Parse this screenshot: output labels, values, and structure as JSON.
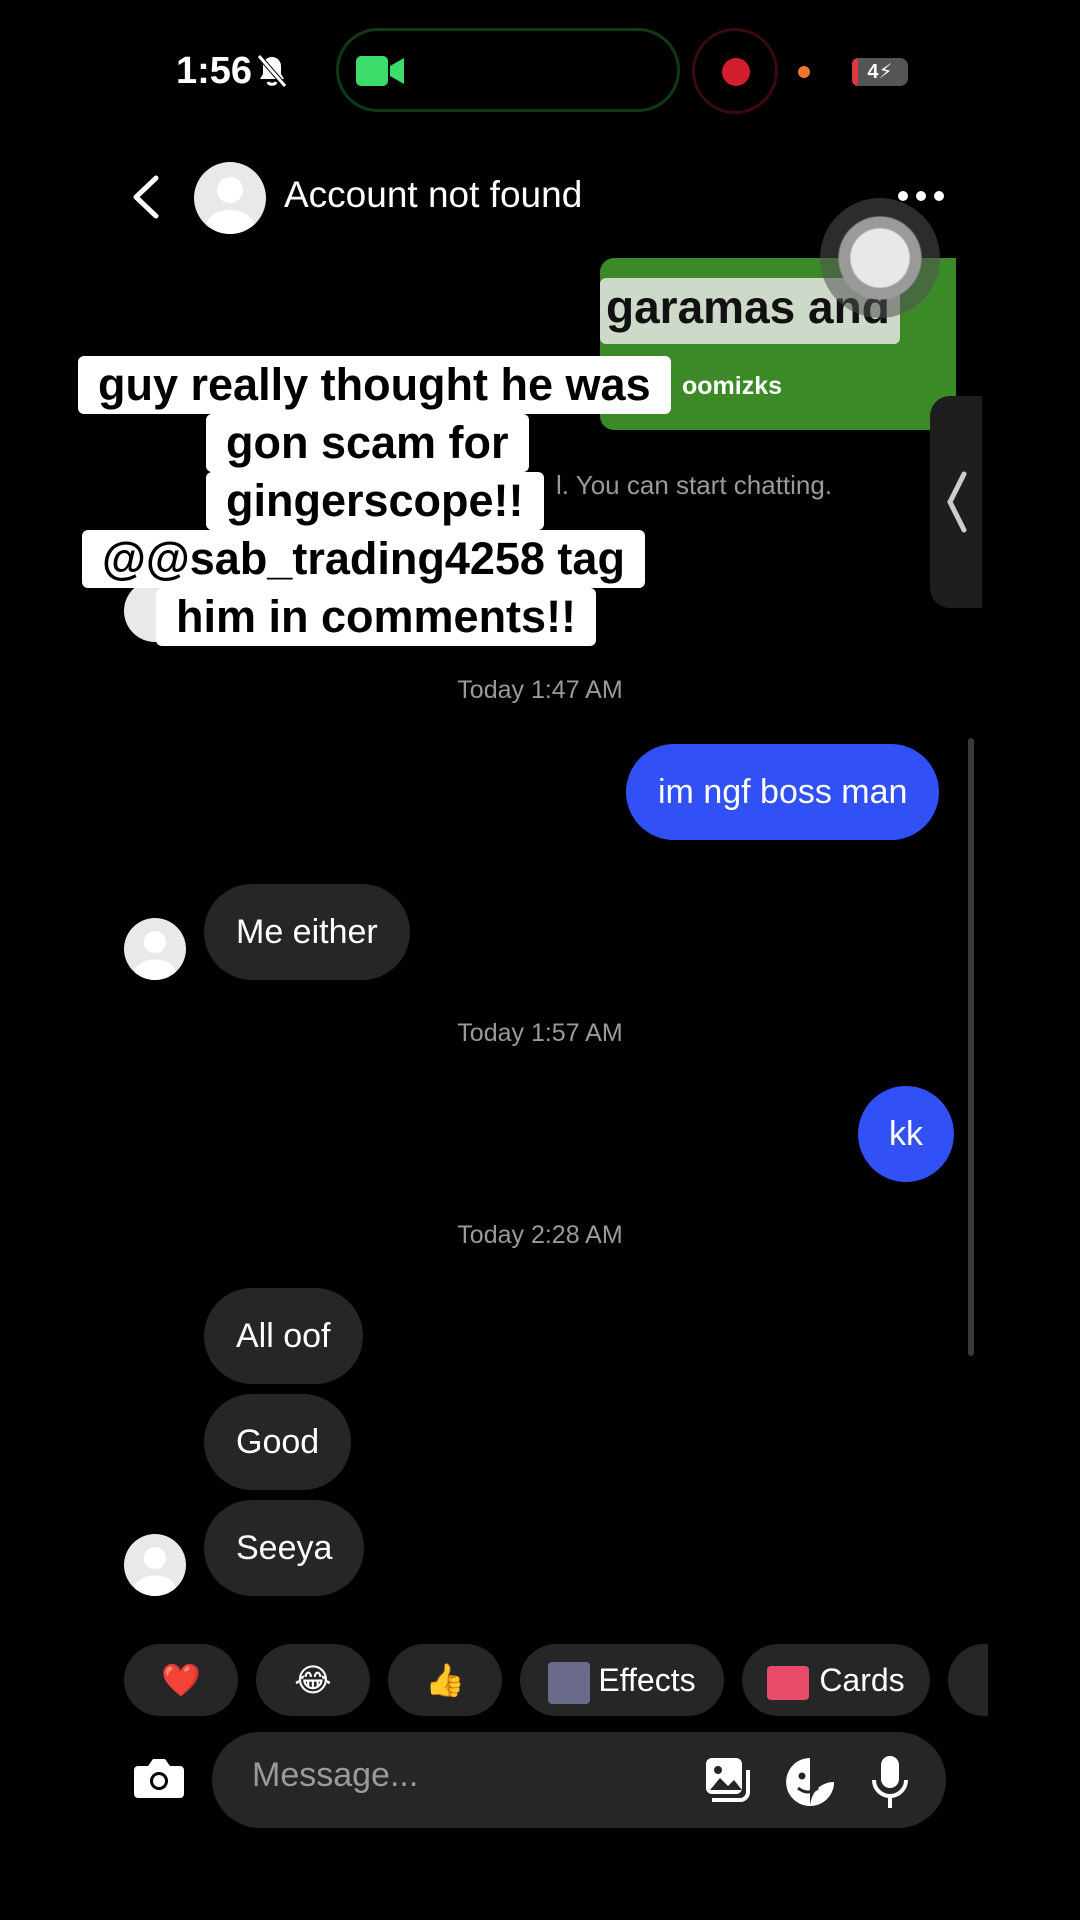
{
  "status_bar": {
    "time": "1:56",
    "battery": "4"
  },
  "header": {
    "title": "Account not found"
  },
  "shared_post": {
    "visible_text": "garamas and",
    "username": "oomizks"
  },
  "system_note": "l. You can start chatting.",
  "caption_lines": [
    "guy really thought he was",
    "gon scam for",
    "gingerscope!!",
    "@@sab_trading4258 tag",
    "him in comments!!"
  ],
  "messages": {
    "ts1": "Today 1:47 AM",
    "out1": "im ngf boss man",
    "in1": "Me either",
    "ts2": "Today 1:57 AM",
    "out2": "kk",
    "ts3": "Today 2:28 AM",
    "in2": "All oof",
    "in3": "Good",
    "in4": "Seeya"
  },
  "quick_actions": {
    "heart": "❤️",
    "laugh": "😂",
    "thumbs": "👍",
    "effects": "Effects",
    "cards": "Cards"
  },
  "composer": {
    "placeholder": "Message..."
  },
  "colors": {
    "outgoing": "#3150f6",
    "incoming": "#262626",
    "background": "#000000"
  },
  "icons": [
    "muted-bell-icon",
    "video-camera-icon",
    "back-arrow-icon",
    "more-icon",
    "camera-icon",
    "gallery-icon",
    "sticker-icon",
    "microphone-icon"
  ]
}
